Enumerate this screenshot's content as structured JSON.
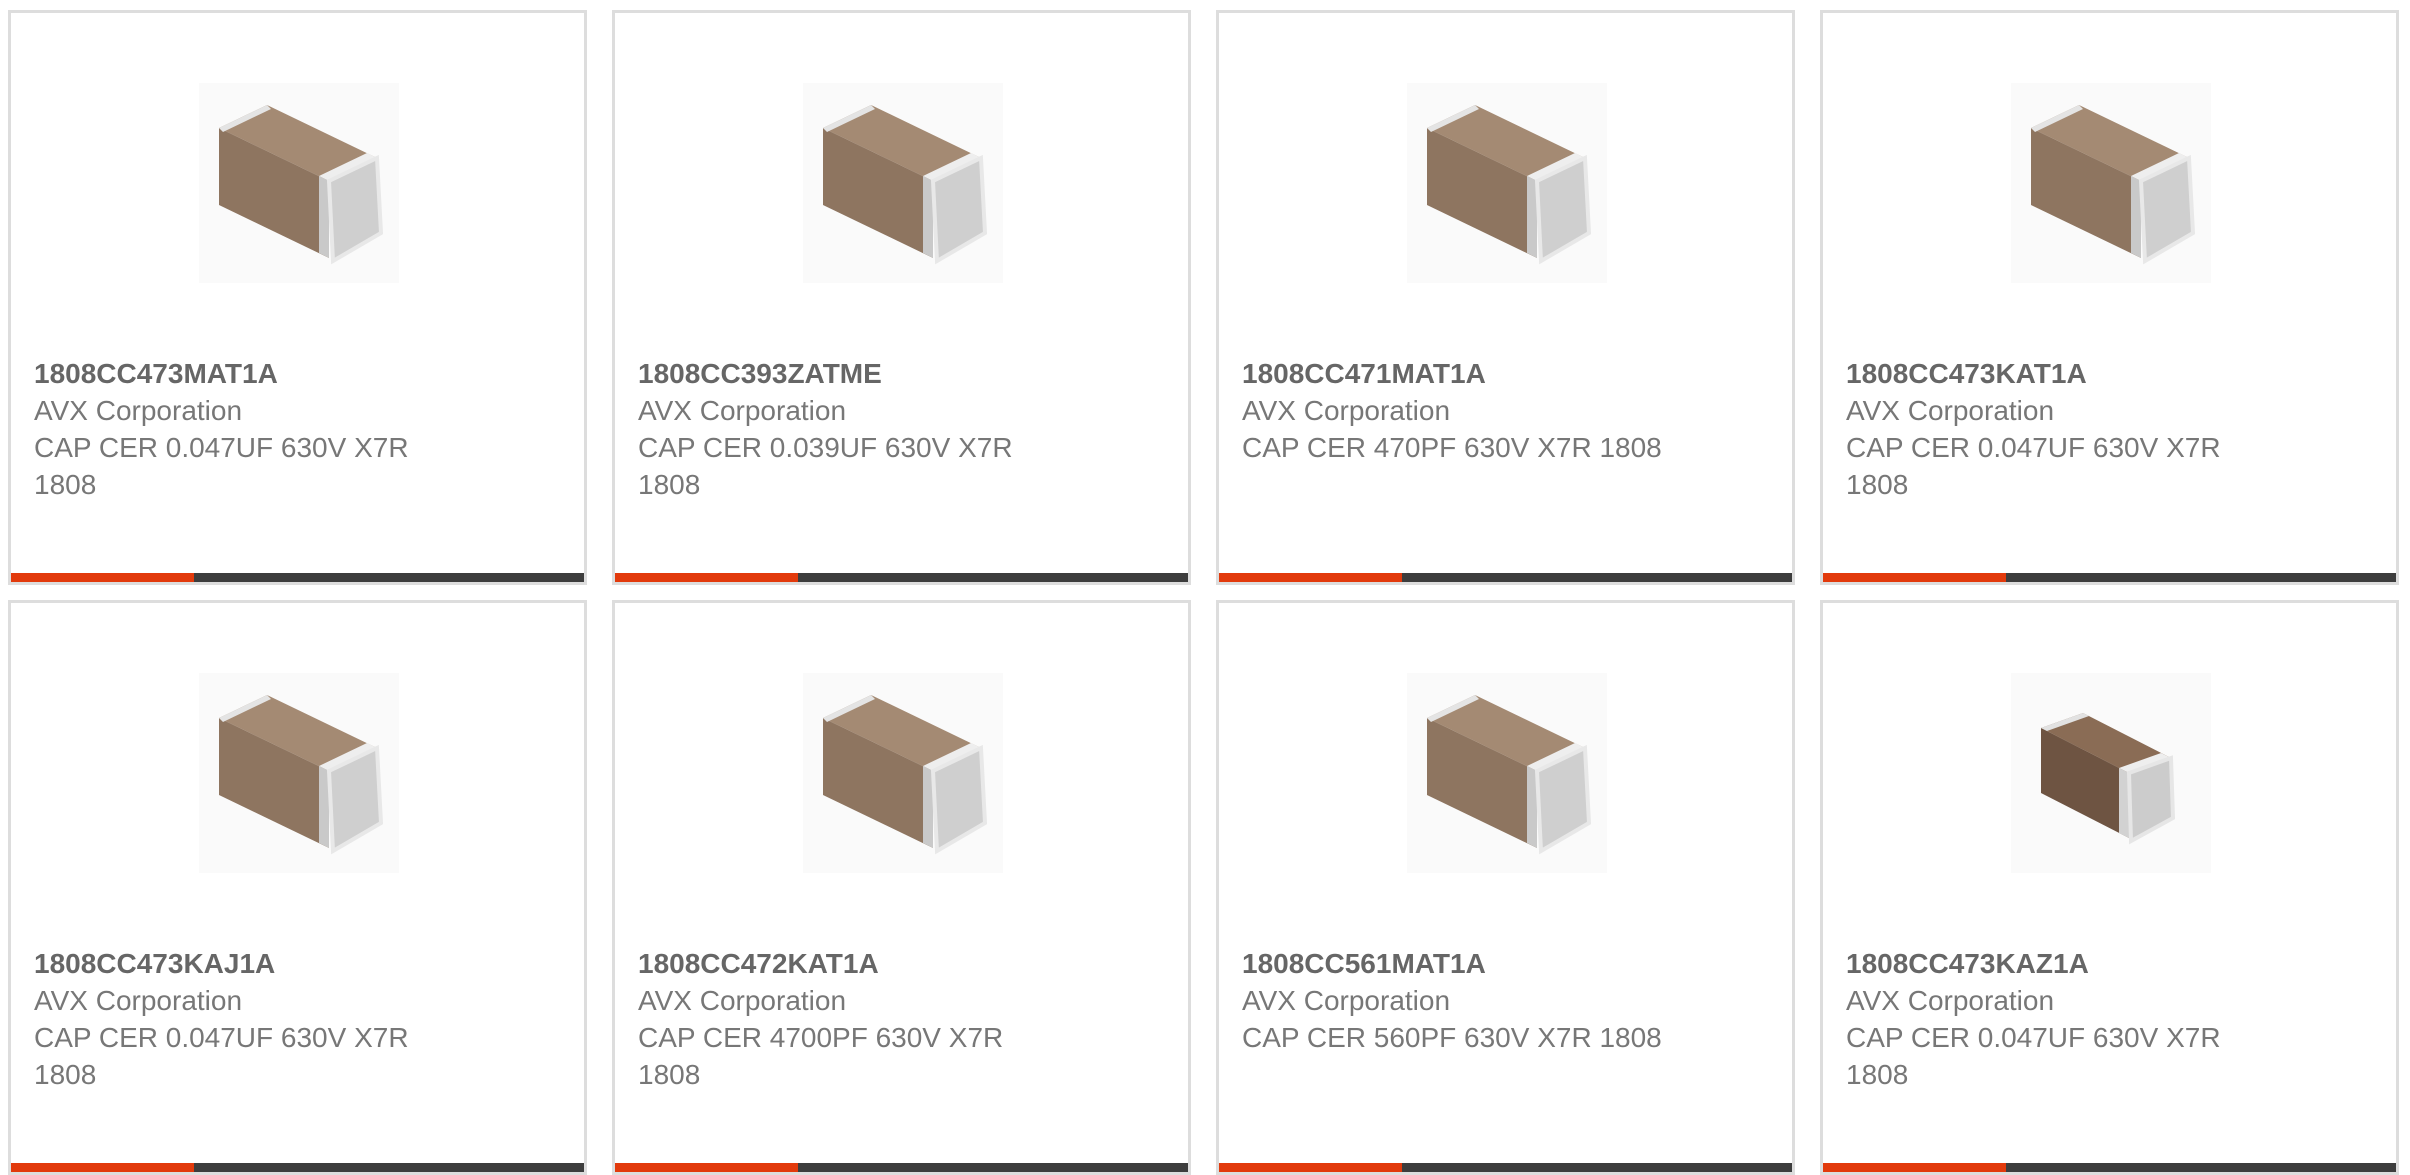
{
  "colors": {
    "accent": "#e23a0c",
    "bar": "#3d3d3d",
    "border": "#dddddd",
    "text": "#777777"
  },
  "products": [
    {
      "part": "1808CC473MAT1A",
      "manufacturer": "AVX Corporation",
      "description": "CAP CER 0.047UF 630V X7R 1808",
      "image": "ceramic-capacitor-icon"
    },
    {
      "part": "1808CC393ZATME",
      "manufacturer": "AVX Corporation",
      "description": "CAP CER 0.039UF 630V X7R 1808",
      "image": "ceramic-capacitor-icon"
    },
    {
      "part": "1808CC471MAT1A",
      "manufacturer": "AVX Corporation",
      "description": "CAP CER 470PF 630V X7R 1808",
      "image": "ceramic-capacitor-icon"
    },
    {
      "part": "1808CC473KAT1A",
      "manufacturer": "AVX Corporation",
      "description": "CAP CER 0.047UF 630V X7R 1808",
      "image": "ceramic-capacitor-icon"
    },
    {
      "part": "1808CC473KAJ1A",
      "manufacturer": "AVX Corporation",
      "description": "CAP CER 0.047UF 630V X7R 1808",
      "image": "ceramic-capacitor-icon"
    },
    {
      "part": "1808CC472KAT1A",
      "manufacturer": "AVX Corporation",
      "description": "CAP CER 4700PF 630V X7R 1808",
      "image": "ceramic-capacitor-icon"
    },
    {
      "part": "1808CC561MAT1A",
      "manufacturer": "AVX Corporation",
      "description": "CAP CER 560PF 630V X7R 1808",
      "image": "ceramic-capacitor-icon"
    },
    {
      "part": "1808CC473KAZ1A",
      "manufacturer": "AVX Corporation",
      "description": "CAP CER 0.047UF 630V X7R 1808",
      "image": "dark-ceramic-capacitor-icon"
    }
  ]
}
